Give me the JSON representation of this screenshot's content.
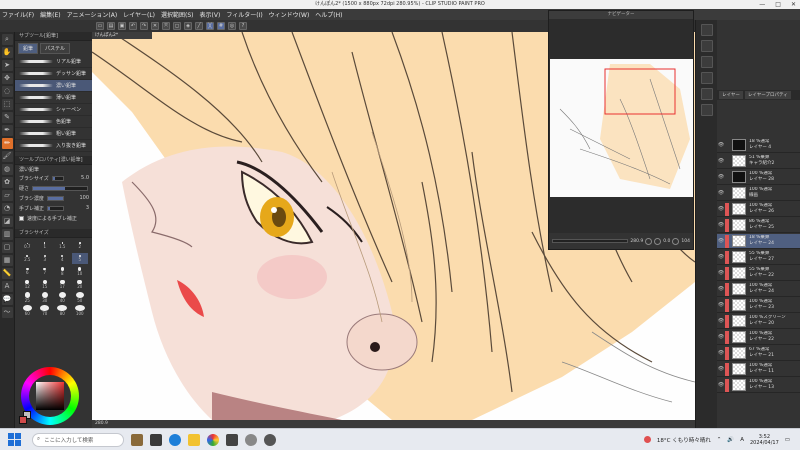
{
  "window": {
    "title": "けんぽん2* (1500 x 880px 72dpi 280.95%) - CLIP STUDIO PAINT PRO",
    "controls": [
      "—",
      "□",
      "✕"
    ]
  },
  "menu": [
    "ファイル(F)",
    "編集(E)",
    "アニメーション(A)",
    "レイヤー(L)",
    "選択範囲(S)",
    "表示(V)",
    "フィルター(I)",
    "ウィンドウ(W)",
    "ヘルプ(H)"
  ],
  "document_tab": "けんぽん2*",
  "tool_panel": {
    "header": "サブツール[鉛筆]",
    "subtabs": [
      "鉛筆",
      "パステル"
    ],
    "brushes": [
      "リアル鉛筆",
      "デッサン鉛筆",
      "濃い鉛筆",
      "薄い鉛筆",
      "シャーペン",
      "色鉛筆",
      "粗い鉛筆",
      "入り抜き鉛筆"
    ],
    "selected_brush_index": 2
  },
  "tool_property": {
    "header": "ツールプロパティ[濃い鉛筆]",
    "brush_name": "濃い鉛筆",
    "items": [
      {
        "label": "ブラシサイズ",
        "value": "5.0"
      },
      {
        "label": "硬さ",
        "value": ""
      },
      {
        "label": "ブラシ濃度",
        "value": "100"
      },
      {
        "label": "手ブレ補正",
        "value": "3"
      }
    ],
    "checkbox_label": "速度による手ブレ補正"
  },
  "brush_size_panel": {
    "header": "ブラシサイズ",
    "sizes": [
      "0.7",
      "1",
      "1.5",
      "2",
      "2.5",
      "3",
      "4",
      "5",
      "6",
      "7",
      "8",
      "10",
      "12",
      "15",
      "17",
      "20",
      "25",
      "30",
      "40",
      "50",
      "60",
      "70",
      "80",
      "100"
    ],
    "selected": "5"
  },
  "navigator": {
    "header": "ナビゲーター",
    "zoom": "280.9",
    "rotation": "0.0",
    "flip": "104"
  },
  "layer_panel": {
    "tabs": [
      "レイヤー",
      "レイヤープロパティ"
    ],
    "layers": [
      {
        "mode": "18 %通常",
        "name": "レイヤー 4",
        "dark": true
      },
      {
        "mode": "51 %乗算",
        "name": "キャラ紹介2",
        "dark": false
      },
      {
        "mode": "100 %通常",
        "name": "レイヤー 28",
        "dark": true
      },
      {
        "mode": "100 %通常",
        "name": "線画",
        "dark": false
      },
      {
        "mode": "100 %通常",
        "name": "レイヤー 26",
        "dark": false
      },
      {
        "mode": "86 %通常",
        "name": "レイヤー 25",
        "dark": false
      },
      {
        "mode": "18 %乗算",
        "name": "レイヤー 24",
        "dark": false
      },
      {
        "mode": "55 %乗算",
        "name": "レイヤー 27",
        "dark": false
      },
      {
        "mode": "55 %乗算",
        "name": "レイヤー 22",
        "dark": false
      },
      {
        "mode": "100 %通常",
        "name": "レイヤー 24",
        "dark": false
      },
      {
        "mode": "100 %通常",
        "name": "レイヤー 23",
        "dark": false
      },
      {
        "mode": "100 %スクリーン",
        "name": "レイヤー 20",
        "dark": false
      },
      {
        "mode": "100 %通常",
        "name": "レイヤー 22",
        "dark": false
      },
      {
        "mode": "67 %通常",
        "name": "レイヤー 21",
        "dark": false
      },
      {
        "mode": "100 %通常",
        "name": "レイヤー 11",
        "dark": false
      },
      {
        "mode": "100 %通常",
        "name": "レイヤー 13",
        "dark": false
      }
    ],
    "selected_index": 6
  },
  "colors": {
    "main": "#d04a4a",
    "sub": "#c0c0c0",
    "hair": "#fbdcae",
    "accent": "#e0702a"
  },
  "taskbar": {
    "search_placeholder": "ここに入力して検索",
    "weather": "18°C くもり時々晴れ",
    "time": "3:52",
    "date": "2024/04/17"
  }
}
